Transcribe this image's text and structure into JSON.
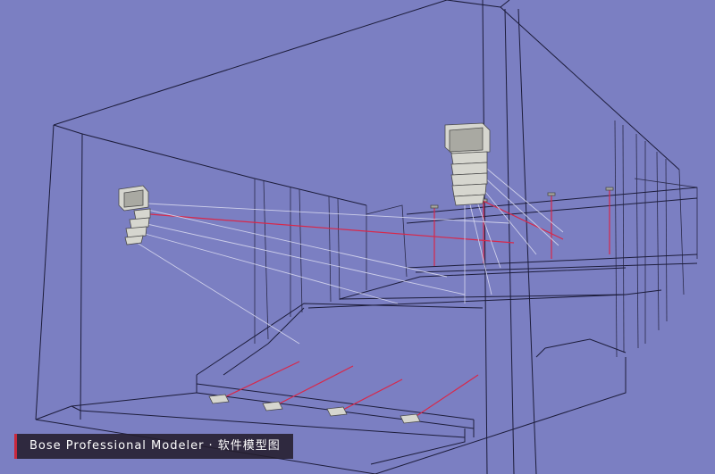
{
  "app": {
    "caption": "Bose Professional Modeler · 软件模型图"
  },
  "colors": {
    "background": "#7b7fc2",
    "wireframe": "#1c1c3a",
    "ray_red": "#d8284a",
    "ray_white": "#d7d8ef",
    "speaker": "#d6d6cf"
  },
  "objects": {
    "speakers": [
      "loudspeaker-left",
      "loudspeaker-right"
    ],
    "front_fill_count": 4
  }
}
